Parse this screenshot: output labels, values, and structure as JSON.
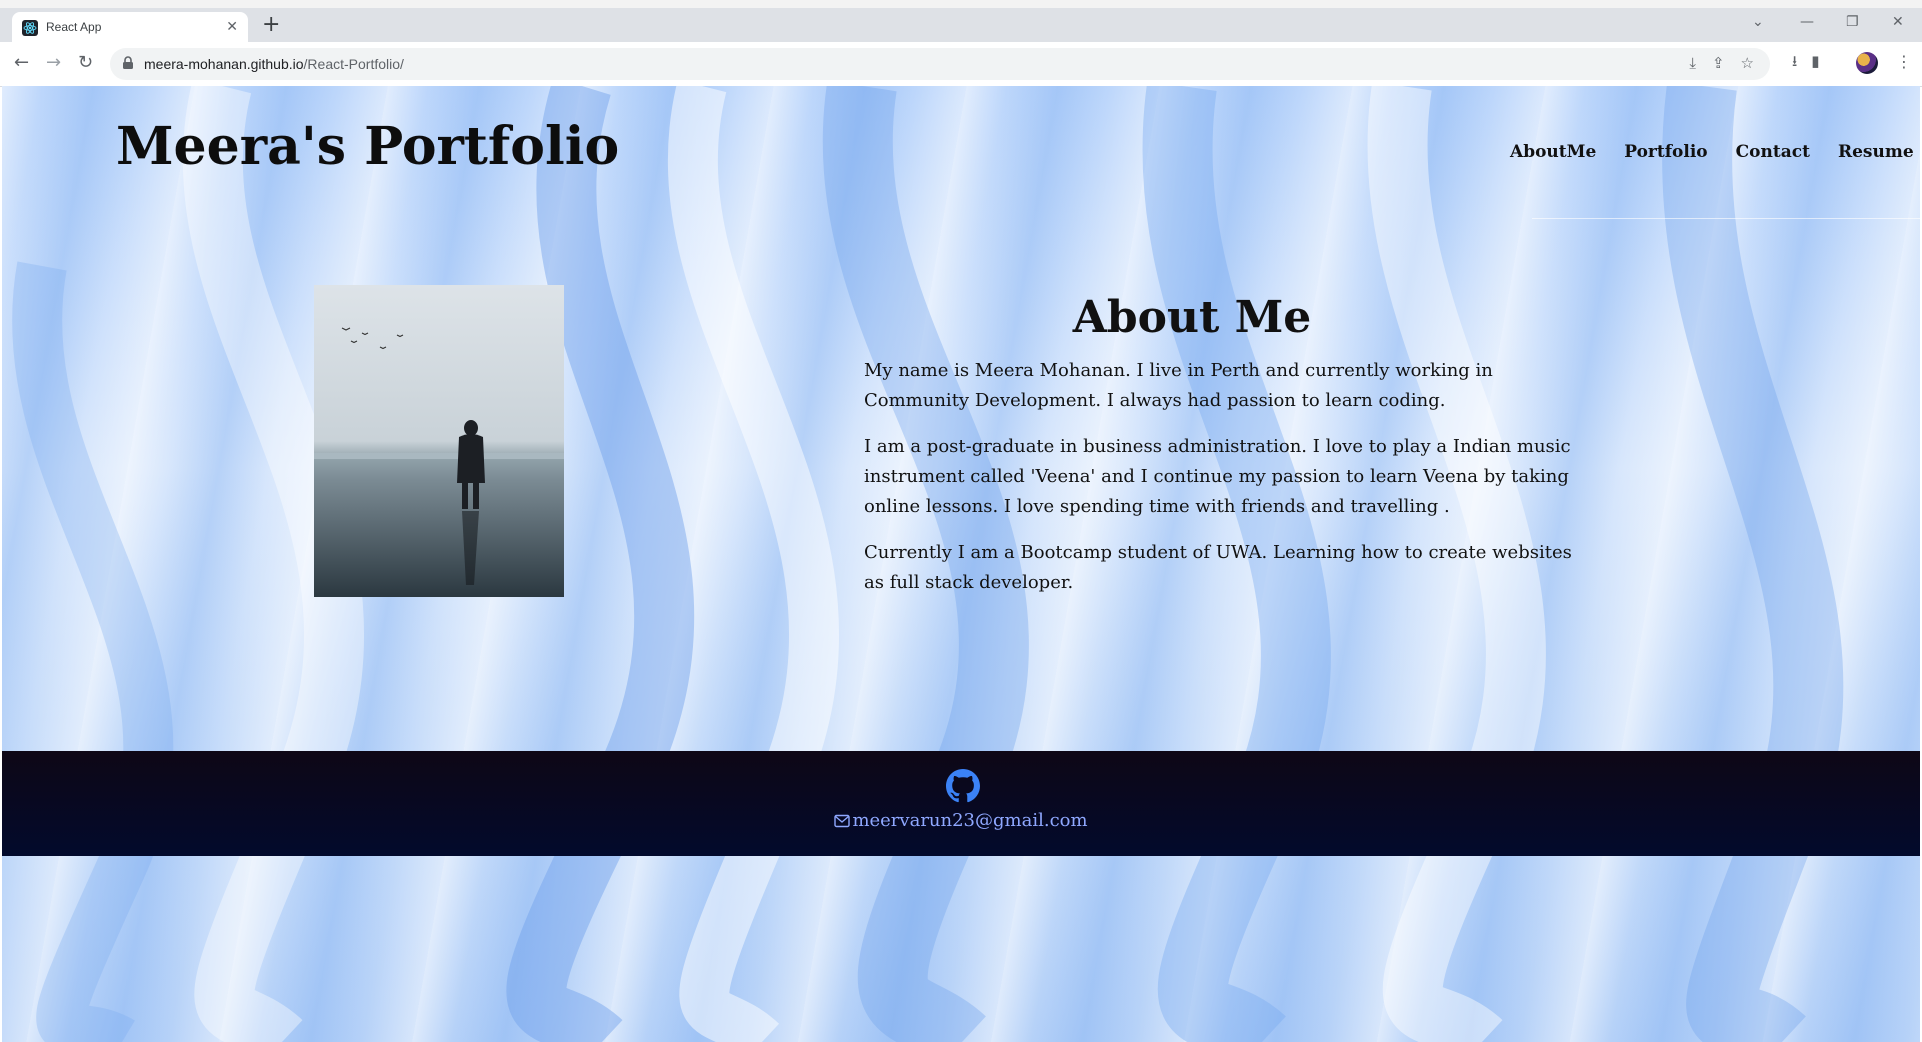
{
  "browser": {
    "tab_title": "React App",
    "url_host": "meera-mohanan.github.io",
    "url_path": "/React-Portfolio/"
  },
  "site": {
    "title": "Meera's Portfolio",
    "nav": [
      "AboutMe",
      "Portfolio",
      "Contact",
      "Resume"
    ]
  },
  "about": {
    "heading": "About Me",
    "paragraphs": [
      "My name is Meera Mohanan. I live in Perth and currently working in Community Development. I always had passion to learn coding.",
      "I am a post-graduate in business administration. I love to play a Indian music instrument called 'Veena' and I continue my passion to learn Veena by taking online lessons. I love spending time with friends and travelling .",
      "Currently I am a Bootcamp student of UWA. Learning how to create websites as full stack developer."
    ]
  },
  "footer": {
    "email": "meervarun23@gmail.com",
    "icons": [
      "github-icon",
      "mail-icon"
    ]
  },
  "colors": {
    "footer_bg": "#020a2c",
    "link": "#8fa8ff",
    "github_icon": "#3b82f6"
  }
}
